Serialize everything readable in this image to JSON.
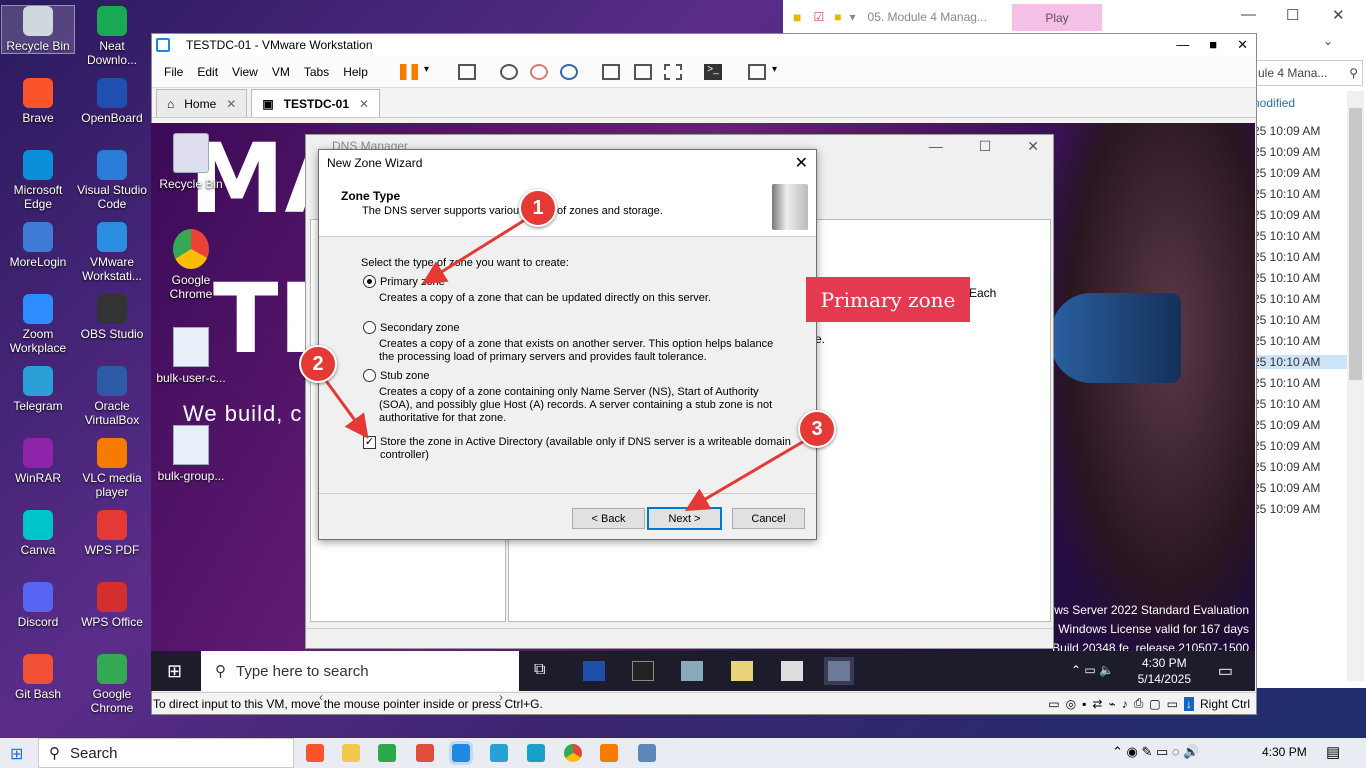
{
  "host_desktop": {
    "icons_col1": [
      "Recycle Bin",
      "Brave",
      "Microsoft Edge",
      "MoreLogin",
      "Zoom Workplace",
      "Telegram",
      "WinRAR",
      "Canva",
      "Discord",
      "Git Bash"
    ],
    "icons_col2": [
      "Neat Downlo...",
      "OpenBoard",
      "Visual Studio Code",
      "VMware Workstati...",
      "OBS Studio",
      "Oracle VirtualBox",
      "VLC media player",
      "WPS PDF",
      "WPS Office",
      "Google Chrome"
    ]
  },
  "bg_explorer": {
    "tab_title": "05. Module 4 Manag...",
    "play_tab": "Play",
    "search_placeholder": "ule 4 Mana...",
    "column_header": "nodified",
    "times": [
      "25 10:09 AM",
      "25 10:09 AM",
      "25 10:09 AM",
      "25 10:10 AM",
      "25 10:09 AM",
      "25 10:10 AM",
      "25 10:10 AM",
      "25 10:10 AM",
      "25 10:10 AM",
      "25 10:10 AM",
      "25 10:10 AM",
      "25 10:10 AM",
      "25 10:10 AM",
      "25 10:10 AM",
      "25 10:09 AM",
      "25 10:09 AM",
      "25 10:09 AM",
      "25 10:09 AM",
      "25 10:09 AM"
    ],
    "selected_index": 11
  },
  "vmware": {
    "title": "TESTDC-01 - VMware Workstation",
    "menus": [
      "File",
      "Edit",
      "View",
      "VM",
      "Tabs",
      "Help"
    ],
    "tabs": [
      {
        "label": "Home"
      },
      {
        "label": "TESTDC-01"
      }
    ],
    "status_text": "To direct input to this VM, move the mouse pointer inside or press Ctrl+G.",
    "right_ctrl": "Right Ctrl"
  },
  "guest": {
    "big_text_1": "MA",
    "big_text_2": "TE",
    "slogan": "We build, c",
    "icons": [
      "Recycle Bin",
      "Google Chrome",
      "bulk-user-c...",
      "bulk-group..."
    ],
    "watermark": [
      "ows Server 2022 Standard Evaluation",
      "Windows License valid for 167 days",
      "Build 20348.fe_release.210507-1500"
    ],
    "search_placeholder": "Type here to search",
    "clock_time": "4:30 PM",
    "clock_date": "5/14/2025"
  },
  "dns_manager": {
    "title": "DNS Manager",
    "partial_right_1": "Each",
    "partial_right_2": "e."
  },
  "wizard": {
    "title": "New Zone Wizard",
    "header": "Zone Type",
    "subheader": "The DNS server supports various types of zones and storage.",
    "prompt": "Select the type of zone you want to create:",
    "options": [
      {
        "label": "Primary zone",
        "desc": "Creates a copy of a zone that can be updated directly on this server.",
        "selected": true
      },
      {
        "label": "Secondary zone",
        "desc": "Creates a copy of a zone that exists on another server. This option helps balance the processing load of primary servers and provides fault tolerance.",
        "selected": false
      },
      {
        "label": "Stub zone",
        "desc": "Creates a copy of a zone containing only Name Server (NS), Start of Authority (SOA), and possibly glue Host (A) records. A server containing a stub zone is not authoritative for that zone.",
        "selected": false
      }
    ],
    "ad_checkbox": {
      "label": "Store the zone in Active Directory (available only if DNS server is a writeable domain controller)",
      "checked": true
    },
    "buttons": {
      "back": "< Back",
      "next": "Next >",
      "cancel": "Cancel"
    }
  },
  "annotations": {
    "badges": [
      "1",
      "2",
      "3"
    ],
    "callout": "Primary zone",
    "color": "#e53935"
  },
  "host_taskbar": {
    "search_label": "Search",
    "clock": "4:30 PM"
  }
}
